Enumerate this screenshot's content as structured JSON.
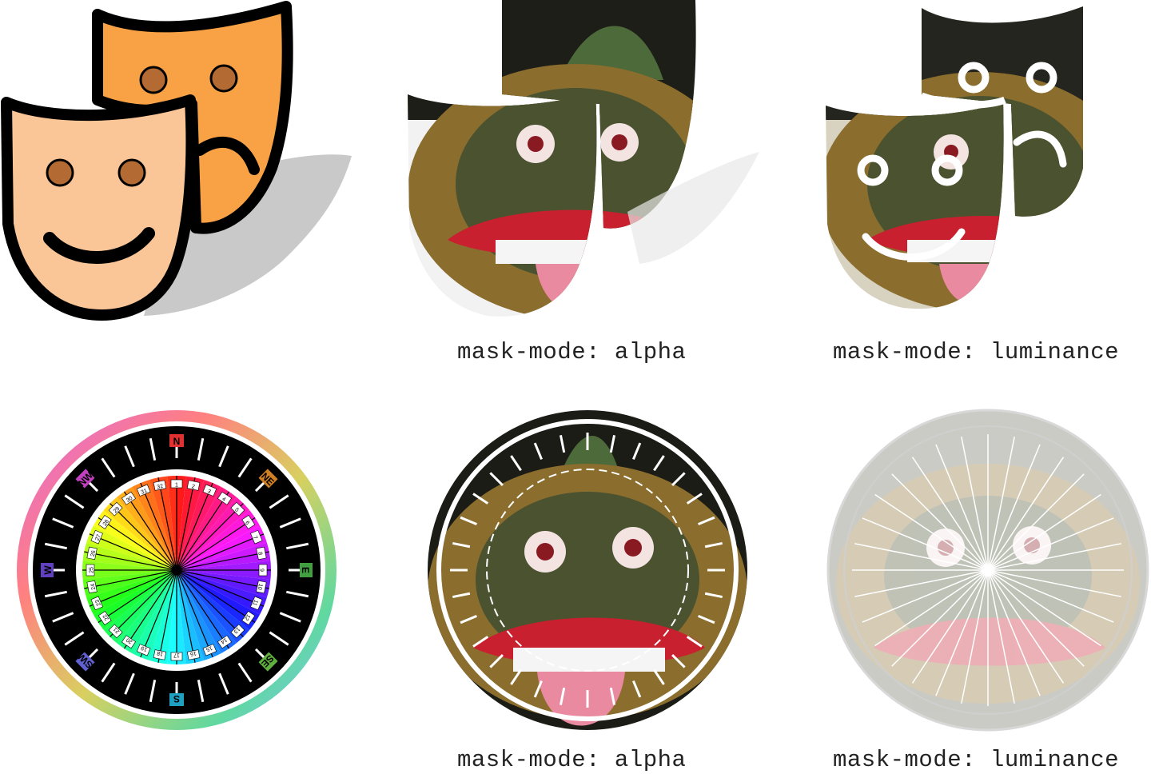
{
  "rows": [
    {
      "id": "masks-row",
      "captions": [
        "mask-mode: alpha",
        "mask-mode: luminance"
      ]
    },
    {
      "id": "compass-row",
      "captions": [
        "mask-mode: alpha",
        "mask-mode: luminance"
      ]
    }
  ],
  "compass": {
    "cardinals": [
      "N",
      "NE",
      "E",
      "SE",
      "S",
      "SW",
      "W",
      "NW"
    ],
    "inner_numbers": [
      "1",
      "2",
      "3",
      "4",
      "5",
      "6",
      "7",
      "8",
      "9",
      "10",
      "11",
      "12",
      "13",
      "14",
      "15",
      "16",
      "17",
      "18",
      "19",
      "20",
      "21",
      "22",
      "23",
      "24",
      "25",
      "26",
      "27",
      "28",
      "29",
      "30",
      "31",
      "32"
    ]
  },
  "colors": {
    "front_mask_fill": "#fbc697",
    "back_mask_fill": "#f9a245",
    "mask_stroke": "#000000",
    "eye_fill": "#b36b33",
    "shadow": "#c7c7c7",
    "mask_gold": "#8a6a2a",
    "mask_green": "#3f4a2a",
    "tongue": "#e98aa0",
    "lip_red": "#c8202e"
  }
}
